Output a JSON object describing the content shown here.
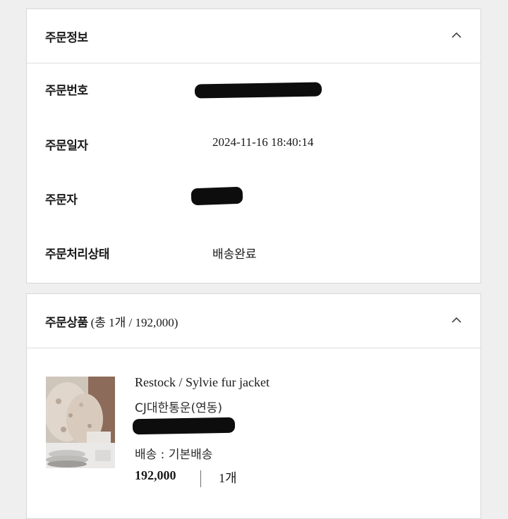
{
  "order_info": {
    "title": "주문정보",
    "rows": [
      {
        "label": "주문번호",
        "value": ""
      },
      {
        "label": "주문일자",
        "value": "2024-11-16 18:40:14"
      },
      {
        "label": "주문자",
        "value": ""
      },
      {
        "label": "주문처리상태",
        "value": "배송완료"
      }
    ]
  },
  "order_items": {
    "title": "주문상품",
    "summary": "(총 1개 / 192,000)",
    "product": {
      "name": "Restock / Sylvie fur jacket",
      "carrier": "CJ대한통운(연동)",
      "shipping": "배송 : 기본배송",
      "price": "192,000",
      "quantity": "1개"
    }
  },
  "icons": {
    "collapse": "chevron-up-icon"
  },
  "colors": {
    "background": "#efefef",
    "panel": "#ffffff",
    "border": "#d7d7d7",
    "redaction": "#0d0d0d"
  }
}
